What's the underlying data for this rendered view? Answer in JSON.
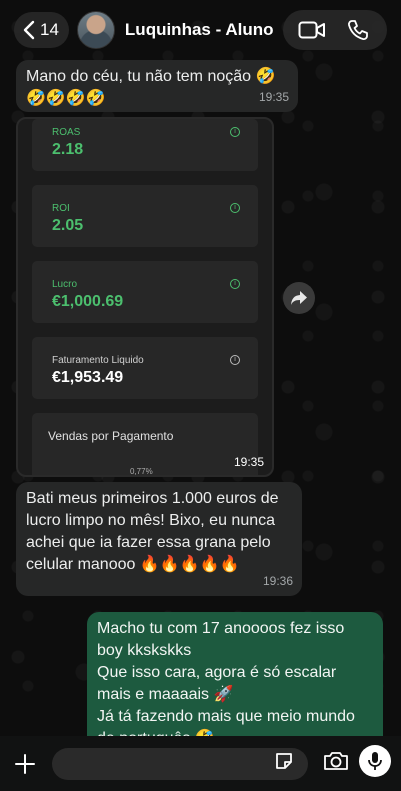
{
  "header": {
    "back_count": "14",
    "contact_name": "Luquinhas - Aluno"
  },
  "messages": {
    "m1": {
      "text_line1": "Mano do céu, tu não tem noção 🤣",
      "text_line2": "🤣🤣🤣🤣",
      "time": "19:35"
    },
    "image": {
      "time": "19:35",
      "cards": [
        {
          "label": "ROAS",
          "value": "2.18",
          "color": "#4cbf6e"
        },
        {
          "label": "ROI",
          "value": "2.05",
          "color": "#4cbf6e"
        },
        {
          "label": "Lucro",
          "value": "€1,000.69",
          "color": "#4cbf6e"
        },
        {
          "label": "Faturamento Liquido",
          "value": "€1,953.49",
          "color": "#ffffff"
        }
      ],
      "section_title": "Vendas por Pagamento",
      "section_footer": "0,77%"
    },
    "m2": {
      "lines": [
        "Bati meus primeiros 1.000 euros de",
        "lucro limpo no mês! Bixo, eu nunca",
        "achei que ia fazer essa grana pelo",
        "celular manooo 🔥🔥🔥🔥🔥"
      ],
      "time": "19:36"
    },
    "m3": {
      "lines": [
        "Macho tu com 17 anoooos fez isso",
        "boy kkskskks",
        "Que isso cara, agora é só escalar",
        "mais e maaaais 🚀",
        "Já tá fazendo mais que meio mundo",
        "de português 🤣"
      ]
    }
  },
  "colors": {
    "outgoing": "#1d5a3f",
    "incoming": "#262727",
    "accent_green": "#4cbf6e"
  },
  "icons": [
    "chevron-left-icon",
    "video-camera-icon",
    "phone-icon",
    "forward-icon",
    "plus-icon",
    "sticker-icon",
    "camera-icon",
    "microphone-icon"
  ]
}
